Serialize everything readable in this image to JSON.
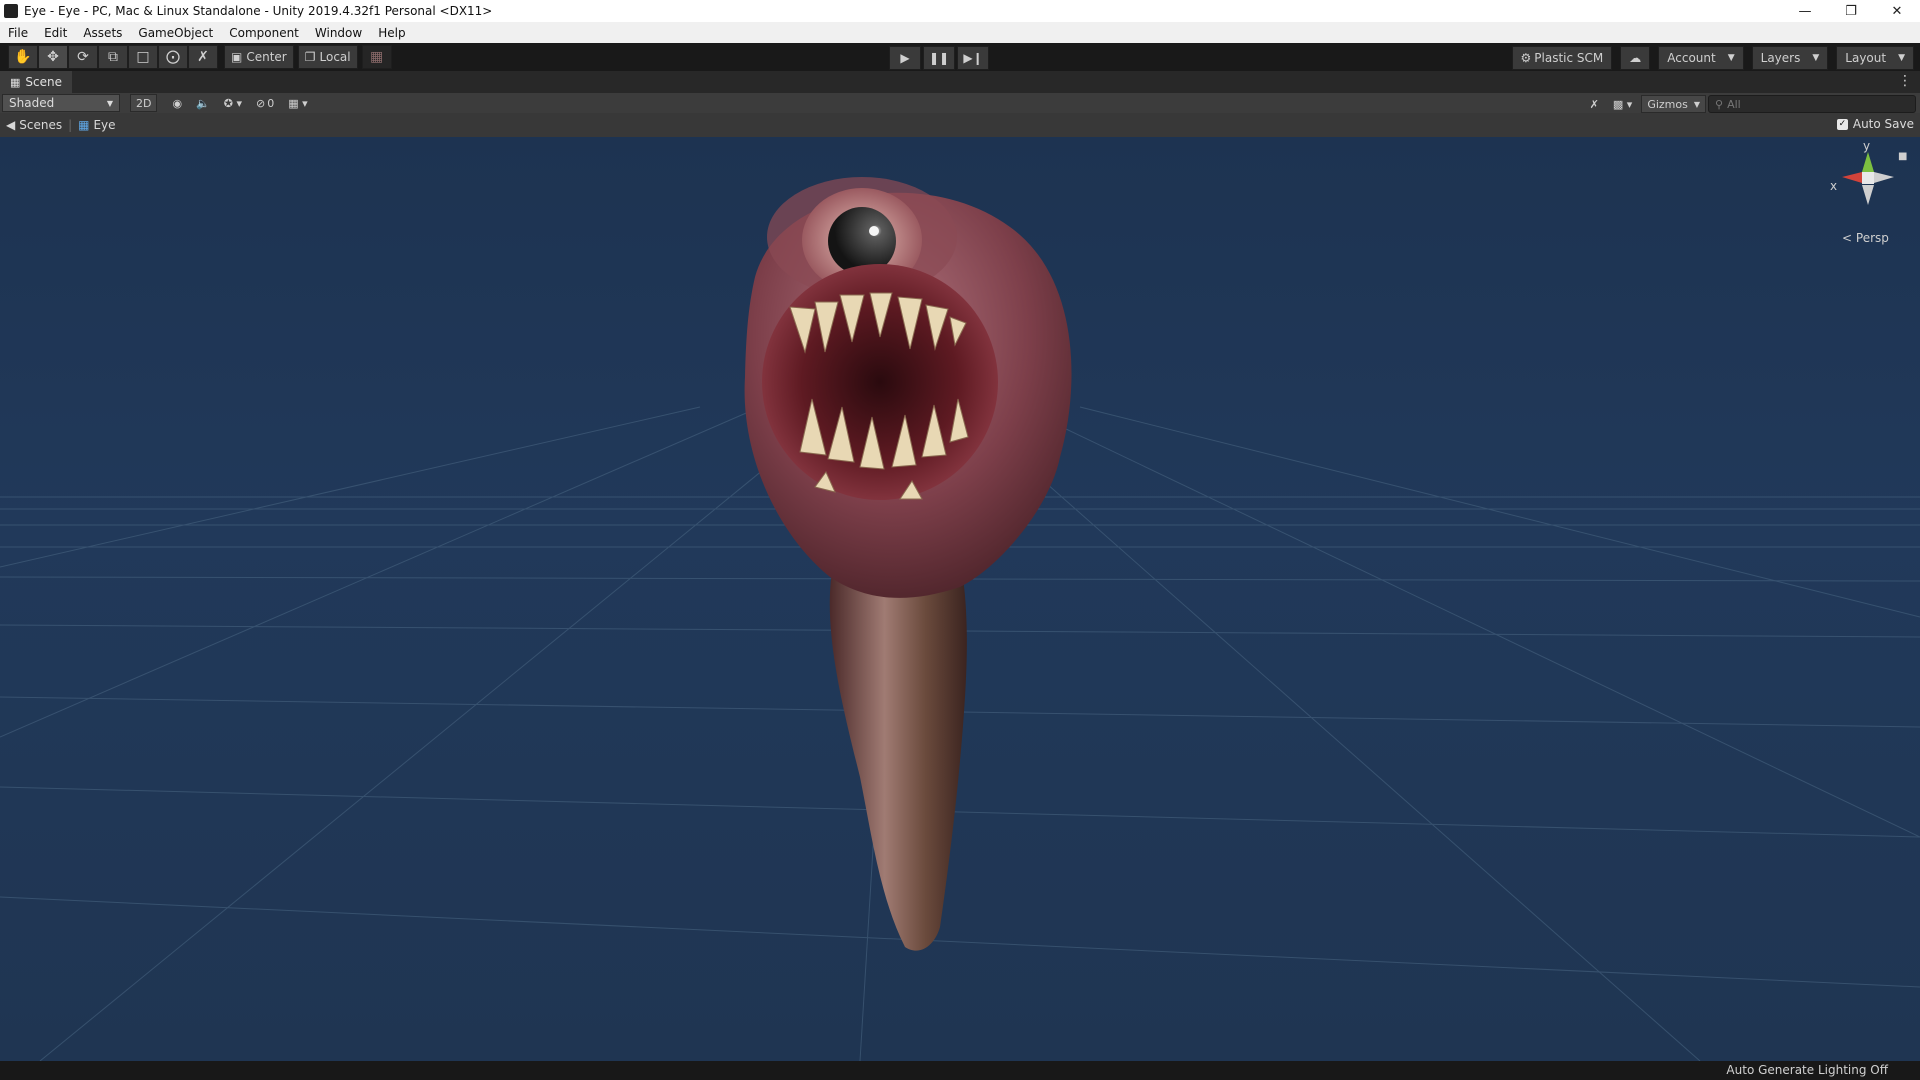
{
  "window": {
    "title": "Eye - Eye - PC, Mac & Linux Standalone - Unity 2019.4.32f1 Personal <DX11>"
  },
  "menu": [
    "File",
    "Edit",
    "Assets",
    "GameObject",
    "Component",
    "Window",
    "Help"
  ],
  "toolbar": {
    "tools": [
      "hand-tool",
      "move-tool",
      "rotate-tool",
      "scale-tool",
      "rect-tool",
      "transform-tool",
      "custom-tool"
    ],
    "pivot_mode": "Center",
    "pivot_rotation": "Local",
    "plastic": "Plastic SCM",
    "account": "Account",
    "layers": "Layers",
    "layout": "Layout"
  },
  "scene_tab": {
    "label": "Scene"
  },
  "scene_bar": {
    "draw_mode": "Shaded",
    "mode_2d": "2D",
    "hidden_count": "0",
    "gizmos": "Gizmos",
    "search_placeholder": "All"
  },
  "breadcrumbs": {
    "root": "Scenes",
    "current": "Eye"
  },
  "auto_save": "Auto Save",
  "gizmo": {
    "y": "y",
    "x": "x",
    "projection": "Persp"
  },
  "status": {
    "lighting": "Auto Generate Lighting Off"
  },
  "colors": {
    "sky": "#1f3552",
    "grid": "#4a6783",
    "x_axis": "#d2433a",
    "y_axis": "#7cc040",
    "z_axis": "#4a78c8"
  }
}
